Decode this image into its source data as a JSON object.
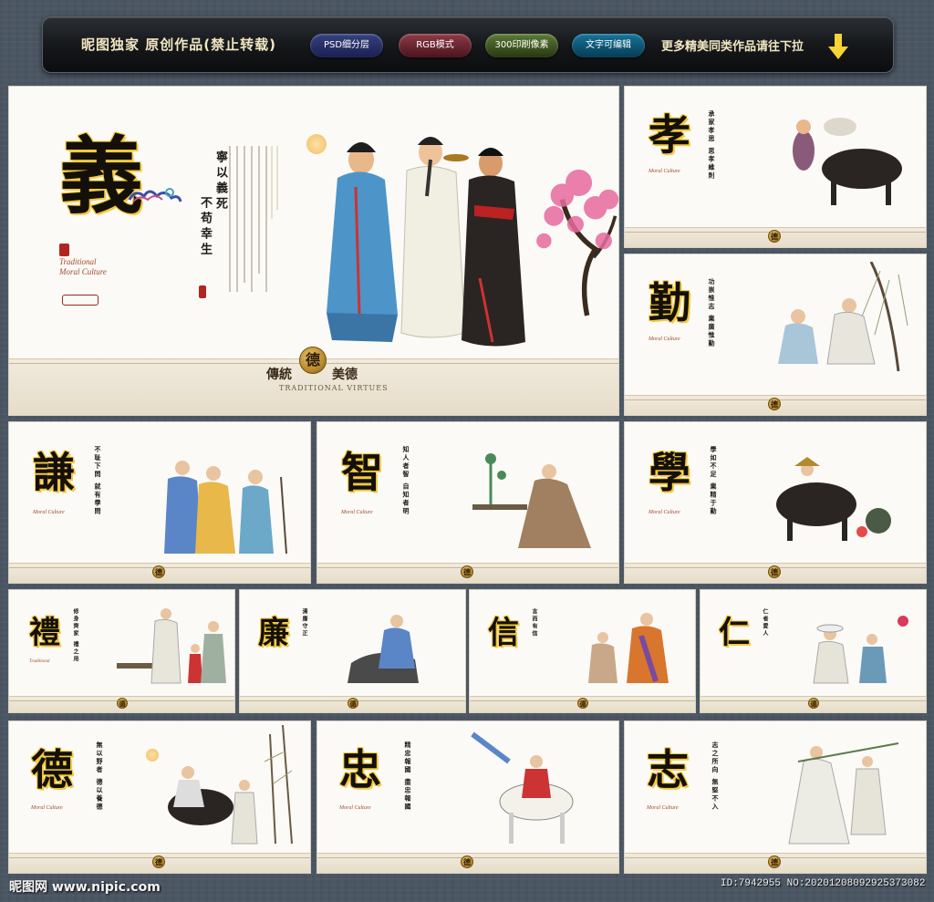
{
  "banner": {
    "title": "昵图独家 原创作品(禁止转载)",
    "tags": [
      "PSD细分层",
      "RGB模式",
      "300印刷像素",
      "文字可编辑"
    ],
    "more": "更多精美同类作品请往下拉"
  },
  "common": {
    "seal_char": "德",
    "seal_left": "傳統",
    "seal_right": "美德",
    "seal_caption": "TRADITIONAL VIRTUES",
    "sub_en_1": "Traditional",
    "sub_en_2": "Moral Culture"
  },
  "hero": {
    "glyph": "義",
    "motto_1": "寧以義死",
    "motto_2": "不苟幸生"
  },
  "panels": [
    {
      "glyph": "孝",
      "motto": "承家孝思 思孝維則"
    },
    {
      "glyph": "勤",
      "motto": "功崇惟志 業廣惟勤"
    },
    {
      "glyph": "謙",
      "motto": "不耻下問 就有學問"
    },
    {
      "glyph": "智",
      "motto": "知人者智 自知者明"
    },
    {
      "glyph": "學",
      "motto": "學如不足 業精于勤"
    },
    {
      "glyph": "禮",
      "motto": "修身齊家 禮之用"
    },
    {
      "glyph": "廉",
      "motto": "清廉守正"
    },
    {
      "glyph": "信",
      "motto": "言而有信"
    },
    {
      "glyph": "仁",
      "motto": "仁者愛人"
    },
    {
      "glyph": "德",
      "motto": "無以野者 德以養德"
    },
    {
      "glyph": "忠",
      "motto": "精忠報國 盡忠報國"
    },
    {
      "glyph": "志",
      "motto": "志之所向 無堅不入"
    }
  ],
  "watermark": {
    "left": "昵图网 www.nipic.com",
    "right": "ID:7942955 NO:20201208092925373082"
  },
  "colors": {
    "page_bg": "#4b5663",
    "gold": "#f3c93e",
    "seal_red": "#b3241f"
  }
}
